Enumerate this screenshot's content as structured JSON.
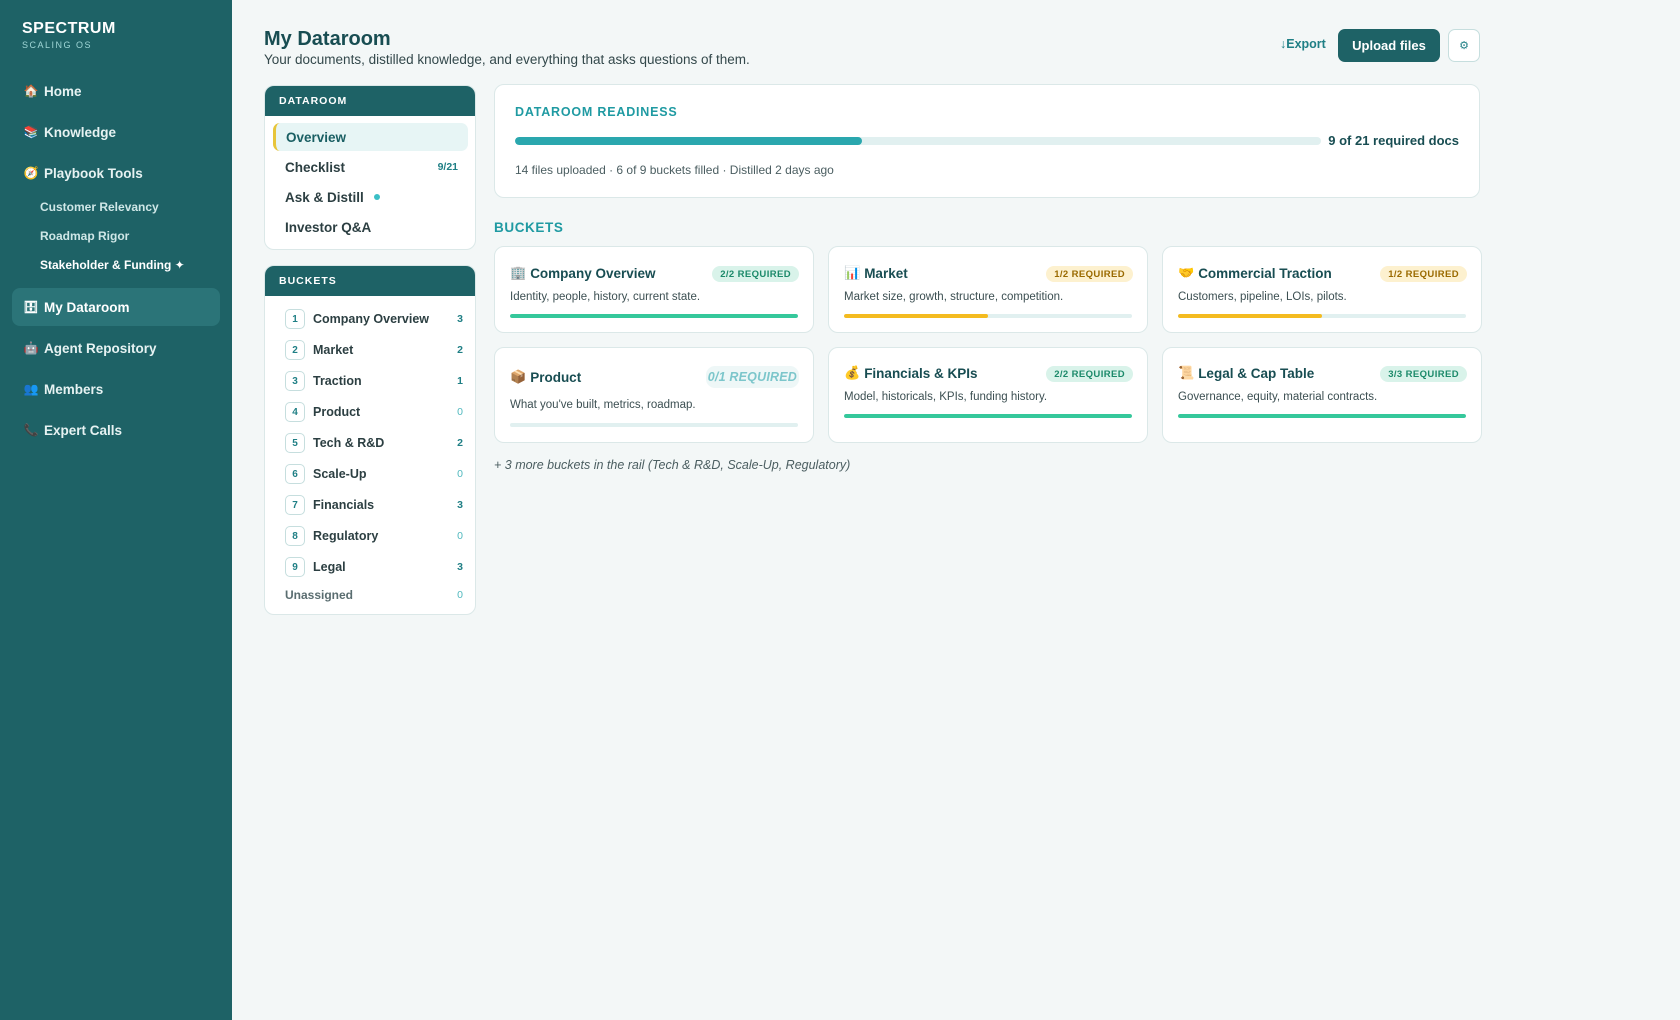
{
  "brand": {
    "title": "SPECTRUM",
    "subtitle": "SCALING OS"
  },
  "nav": {
    "home": {
      "icon": "🏠",
      "label": "Home"
    },
    "knowledge": {
      "icon": "📚",
      "label": "Knowledge"
    },
    "playbook": {
      "icon": "🧭",
      "label": "Playbook Tools"
    },
    "sub": [
      "Customer Relevancy",
      "Roadmap Rigor",
      "Stakeholder & Funding ✦"
    ],
    "dataroom": {
      "icon": "🗄",
      "label": "My Dataroom"
    },
    "agents": {
      "icon": "🤖",
      "label": "Agent Repository"
    },
    "members": {
      "icon": "👥",
      "label": "Members"
    },
    "experts": {
      "icon": "📞",
      "label": "Expert Calls"
    }
  },
  "header": {
    "title": "My Dataroom",
    "subtitle": "Your documents, distilled knowledge, and everything that asks questions of them.",
    "export": "↓Export",
    "upload": "Upload files",
    "settings_icon": "⚙"
  },
  "dataroom_panel": {
    "heading": "DATAROOM",
    "items": [
      {
        "label": "Overview",
        "count": ""
      },
      {
        "label": "Checklist",
        "count": "9/21"
      },
      {
        "label": "Ask & Distill",
        "count": ""
      },
      {
        "label": "Investor Q&A",
        "count": ""
      }
    ]
  },
  "buckets_panel": {
    "heading": "BUCKETS",
    "items": [
      {
        "num": "1",
        "label": "Company Overview",
        "count": "3"
      },
      {
        "num": "2",
        "label": "Market",
        "count": "2"
      },
      {
        "num": "3",
        "label": "Traction",
        "count": "1"
      },
      {
        "num": "4",
        "label": "Product",
        "count": "0"
      },
      {
        "num": "5",
        "label": "Tech & R&D",
        "count": "2"
      },
      {
        "num": "6",
        "label": "Scale-Up",
        "count": "0"
      },
      {
        "num": "7",
        "label": "Financials",
        "count": "3"
      },
      {
        "num": "8",
        "label": "Regulatory",
        "count": "0"
      },
      {
        "num": "9",
        "label": "Legal",
        "count": "3"
      }
    ],
    "unassigned": {
      "label": "Unassigned",
      "count": "0"
    }
  },
  "readiness": {
    "title": "DATAROOM READINESS",
    "progress": 0.43,
    "count": "9 of 21 required docs",
    "meta": "14 files uploaded · 6 of 9 buckets filled · Distilled 2 days ago"
  },
  "buckets_section": {
    "title": "BUCKETS"
  },
  "cards": [
    {
      "icon": "🏢",
      "title": "Company Overview",
      "badge": "2/2 REQUIRED",
      "desc": "Identity, people, history, current state.",
      "progress": 1.0
    },
    {
      "icon": "📊",
      "title": "Market",
      "badge": "1/2 REQUIRED",
      "desc": "Market size, growth, structure, competition.",
      "progress": 0.5
    },
    {
      "icon": "🤝",
      "title": "Commercial Traction",
      "badge": "1/2 REQUIRED",
      "desc": "Customers, pipeline, LOIs, pilots.",
      "progress": 0.5
    },
    {
      "icon": "📦",
      "title": "Product",
      "badge": "0/1 REQUIRED",
      "desc": "What you've built, metrics, roadmap.",
      "progress": 0.0
    },
    {
      "icon": "💰",
      "title": "Financials & KPIs",
      "badge": "2/2 REQUIRED",
      "desc": "Model, historicals, KPIs, funding history.",
      "progress": 1.0
    },
    {
      "icon": "📜",
      "title": "Legal & Cap Table",
      "badge": "3/3 REQUIRED",
      "desc": "Governance, equity, material contracts.",
      "progress": 1.0
    }
  ],
  "more_note": "+ 3 more buckets in the rail (Tech & R&D, Scale-Up, Regulatory)"
}
